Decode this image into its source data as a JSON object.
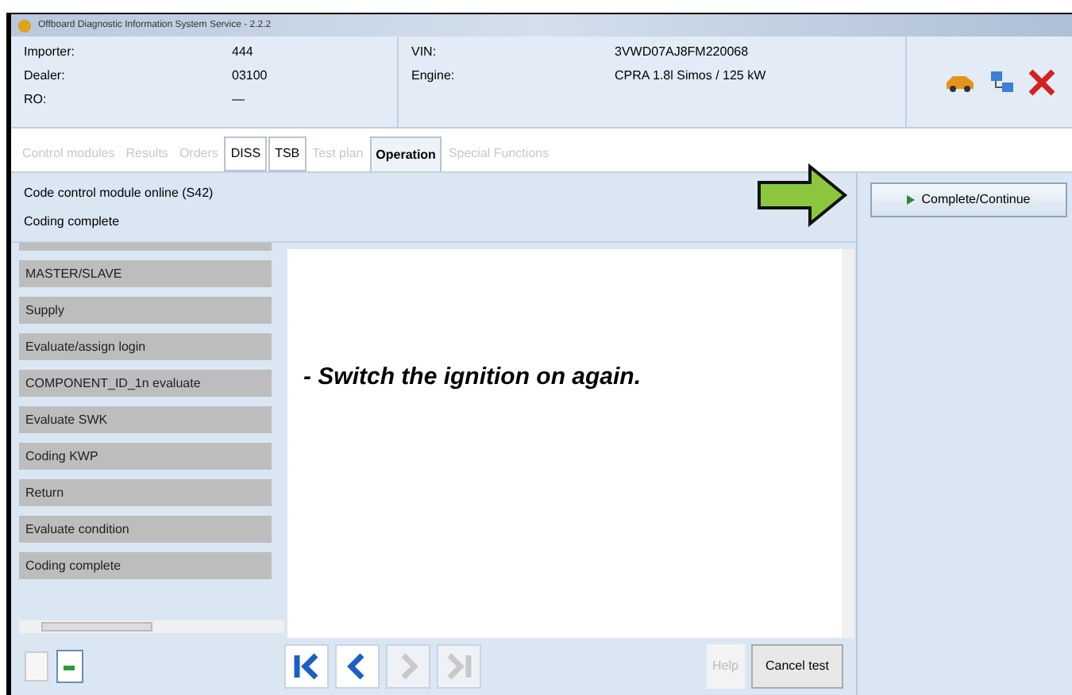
{
  "window": {
    "title": "Offboard Diagnostic Information System Service - 2.2.2"
  },
  "header": {
    "fields": [
      {
        "label": "Importer:",
        "value": "444"
      },
      {
        "label": "Dealer:",
        "value": "03100"
      },
      {
        "label": "RO:",
        "value": "—"
      }
    ],
    "vehicle": [
      {
        "label": "VIN:",
        "value": "3VWD07AJ8FM220068"
      },
      {
        "label": "Engine:",
        "value": "CPRA 1.8l Simos / 125 kW"
      }
    ]
  },
  "tabs": [
    {
      "label": "Control modules",
      "selected": false,
      "disabled": true
    },
    {
      "label": "Results",
      "selected": false,
      "disabled": true
    },
    {
      "label": "Orders",
      "selected": false,
      "disabled": true
    },
    {
      "label": "DISS",
      "selected": false,
      "disabled": false
    },
    {
      "label": "TSB",
      "selected": false,
      "disabled": false
    },
    {
      "label": "Test plan",
      "selected": false,
      "disabled": true
    },
    {
      "label": "Operation",
      "selected": true,
      "disabled": false
    },
    {
      "label": "Special Functions",
      "selected": false,
      "disabled": true
    }
  ],
  "step": {
    "title": "Code control module online (S42)",
    "subtitle": "Coding complete"
  },
  "continue_button": "Complete/Continue",
  "steps": [
    "MASTER/SLAVE",
    "Supply",
    "Evaluate/assign login",
    "COMPONENT_ID_1n evaluate",
    "Evaluate SWK",
    "Coding KWP",
    "Return",
    "Evaluate condition",
    "Coding complete"
  ],
  "instruction": "- Switch the ignition on again.",
  "navigation": [
    {
      "kind": "first",
      "disabled": false
    },
    {
      "kind": "back",
      "disabled": false
    },
    {
      "kind": "next",
      "disabled": true
    },
    {
      "kind": "last",
      "disabled": true
    }
  ],
  "buttons": {
    "help": "Help",
    "cancel": "Cancel test"
  }
}
